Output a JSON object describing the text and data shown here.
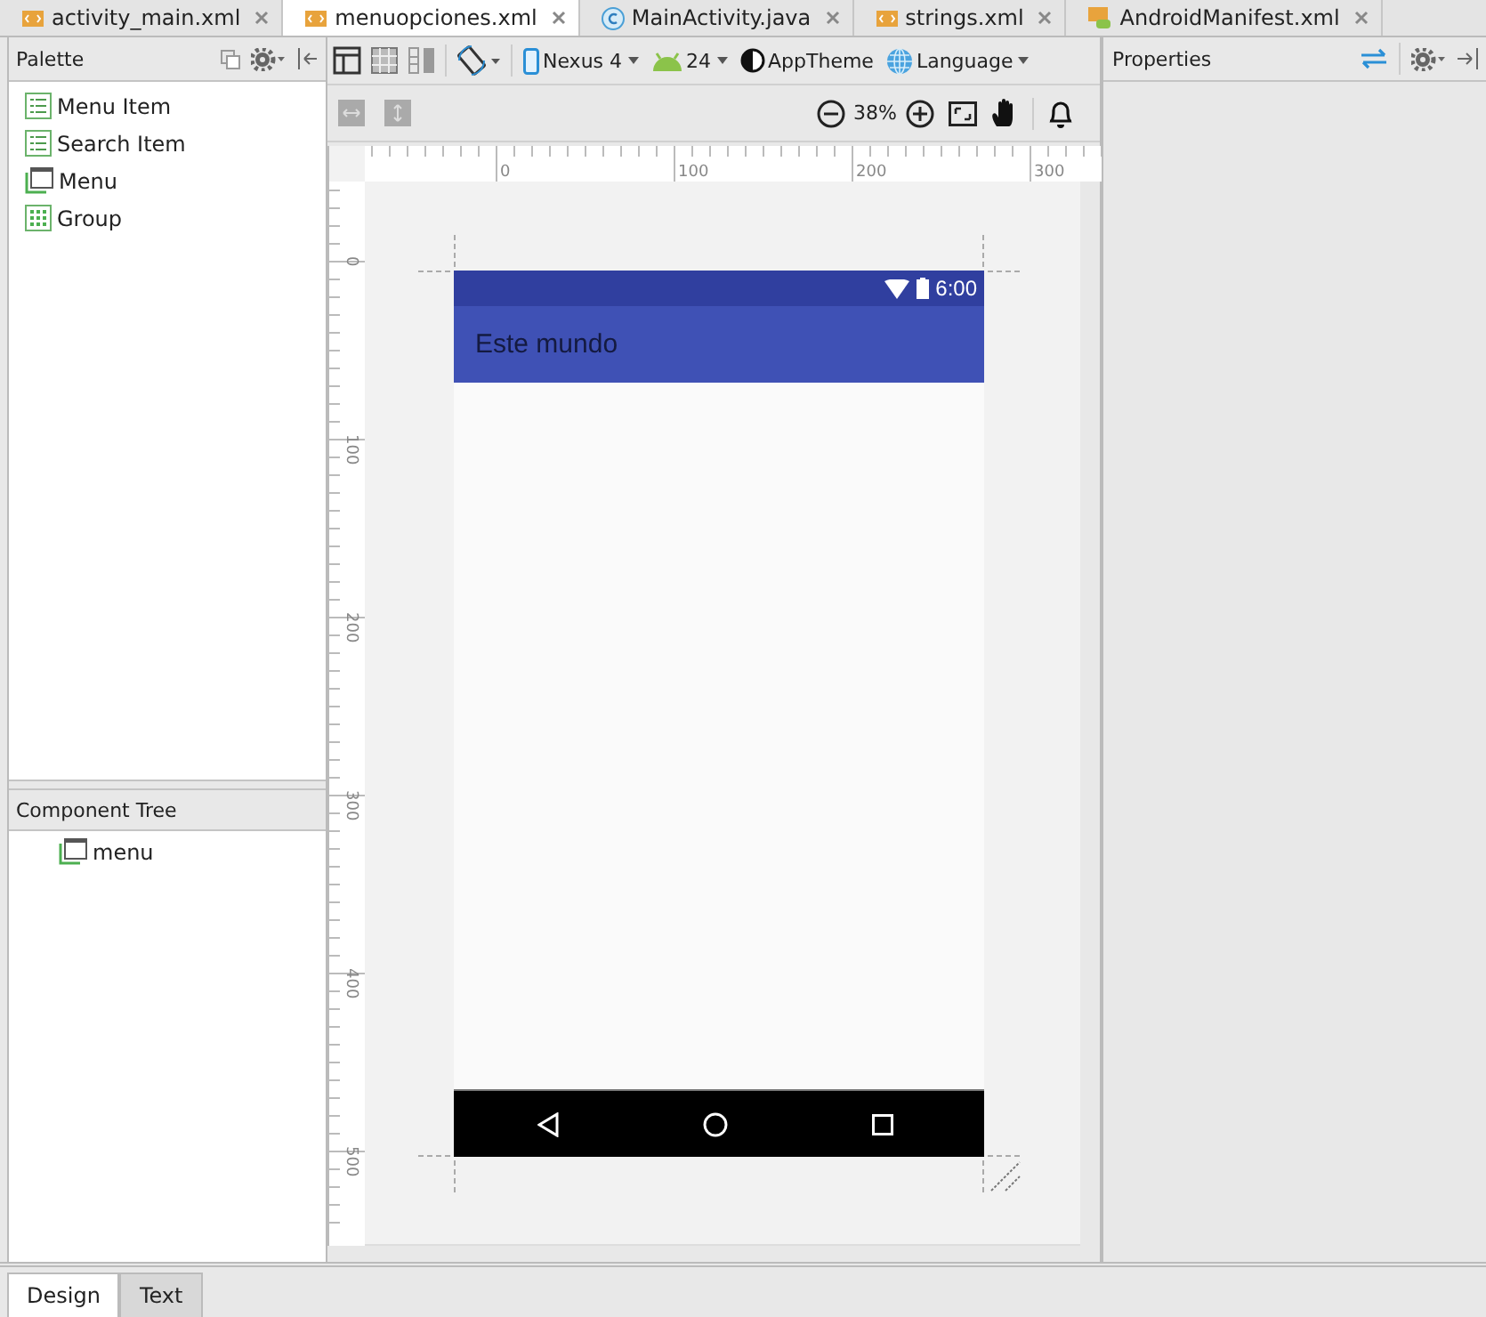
{
  "editor_tabs": [
    {
      "label": "activity_main.xml",
      "kind": "xml",
      "selected": false
    },
    {
      "label": "menuopciones.xml",
      "kind": "xml",
      "selected": true
    },
    {
      "label": "MainActivity.java",
      "kind": "class",
      "selected": false
    },
    {
      "label": "strings.xml",
      "kind": "xml",
      "selected": false
    },
    {
      "label": "AndroidManifest.xml",
      "kind": "manifest",
      "selected": false
    }
  ],
  "palette": {
    "title": "Palette",
    "items": [
      {
        "label": "Menu Item",
        "kind": "list"
      },
      {
        "label": "Search Item",
        "kind": "list"
      },
      {
        "label": "Menu",
        "kind": "menu"
      },
      {
        "label": "Group",
        "kind": "grid"
      }
    ]
  },
  "toolbar": {
    "device": "Nexus 4",
    "api": "24",
    "theme": "AppTheme",
    "language": "Language",
    "zoom": "38%"
  },
  "ruler": {
    "x_labels": [
      "0",
      "100",
      "200",
      "300"
    ],
    "y_labels": [
      "0",
      "100",
      "200",
      "300",
      "400",
      "500"
    ]
  },
  "preview": {
    "time": "6:00",
    "app_title": "Este mundo"
  },
  "component_tree": {
    "title": "Component Tree",
    "items": [
      {
        "label": "menu",
        "kind": "menu"
      }
    ]
  },
  "properties": {
    "title": "Properties"
  },
  "bottom_tabs": [
    {
      "label": "Design",
      "selected": true
    },
    {
      "label": "Text",
      "selected": false
    }
  ]
}
